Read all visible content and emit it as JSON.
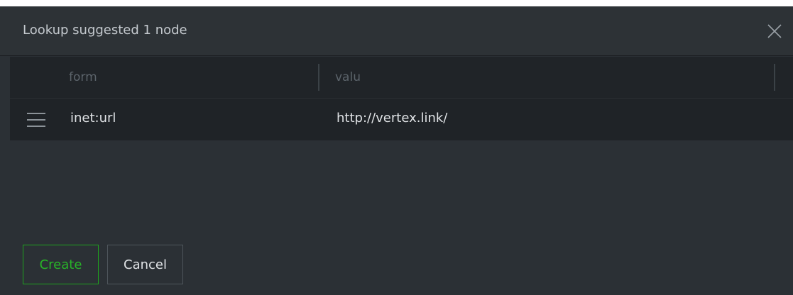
{
  "dialog": {
    "title": "Lookup suggested 1 node",
    "close_icon": "close-icon"
  },
  "grid": {
    "columns": [
      {
        "label": "form"
      },
      {
        "label": "valu"
      }
    ],
    "rows": [
      {
        "drag_icon": "drag-handle-icon",
        "form": "inet:url",
        "valu": "http://vertex.link/"
      }
    ]
  },
  "footer": {
    "create_label": "Create",
    "cancel_label": "Cancel"
  },
  "colors": {
    "dialog_bg": "#2b3035",
    "grid_header_bg": "#202428",
    "row_bg": "#1f2327",
    "create_accent": "#28b428"
  }
}
